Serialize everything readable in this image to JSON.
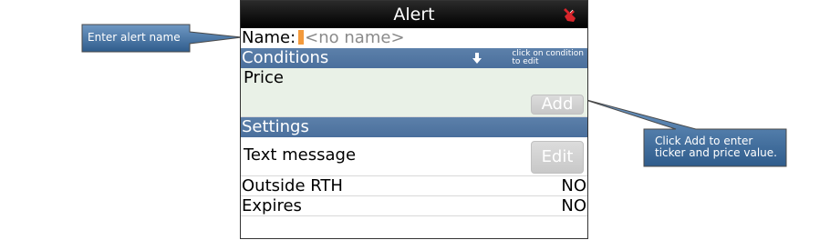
{
  "callouts": {
    "left": "Enter alert name",
    "right_line1": "Click Add to enter",
    "right_line2": "ticker and price value."
  },
  "screen": {
    "title": "Alert",
    "title_icon": "red-hand-icon",
    "name_label": "Name:",
    "name_placeholder": "<no name>",
    "conditions": {
      "header": "Conditions",
      "hint_line1": "click on condition",
      "hint_line2": "to edit",
      "price_label": "Price",
      "add_label": "Add"
    },
    "settings": {
      "header": "Settings",
      "text_message_label": "Text message",
      "edit_label": "Edit",
      "outside_rth_label": "Outside RTH",
      "outside_rth_value": "NO",
      "expires_label": "Expires",
      "expires_value": "NO"
    }
  },
  "colors": {
    "callout_fill": "#3f6f9f",
    "section_header": "#4f75a3",
    "cursor": "#f39a3c",
    "price_row_bg": "#e9f1e7"
  }
}
